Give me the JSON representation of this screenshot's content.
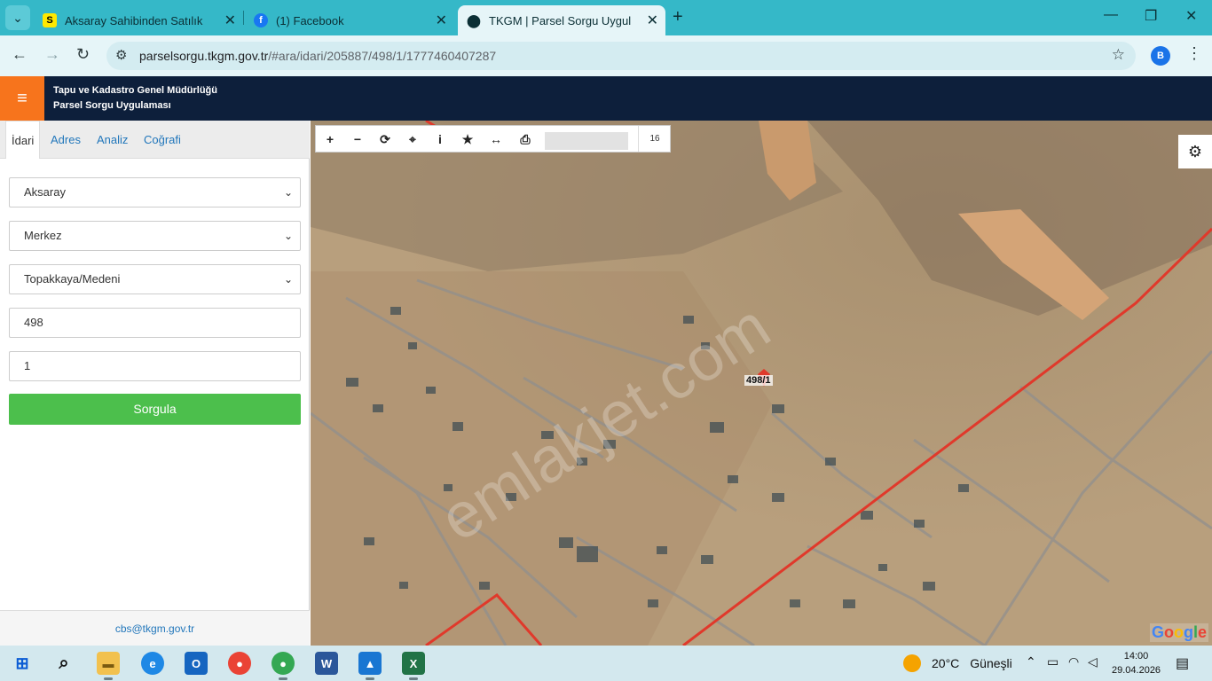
{
  "browser": {
    "tabs": [
      {
        "favicon": "S",
        "title": "Aksaray Sahibinden Satılık Dair"
      },
      {
        "favicon": "facebook-icon",
        "title": "(1) Facebook"
      },
      {
        "favicon": "location-pin-icon",
        "title": "TKGM | Parsel Sorgu Uygulama"
      }
    ],
    "url_host": "parselsorgu.tkgm.gov.tr",
    "url_path": "/#ara/idari/205887/498/1/1777460407287",
    "profile_initial": "B"
  },
  "app": {
    "title_line1": "Tapu ve Kadastro Genel Müdürlüğü",
    "title_line2": "Parsel Sorgu Uygulaması"
  },
  "panel": {
    "tabs": [
      "İdari",
      "Adres",
      "Analiz",
      "Coğrafi"
    ],
    "il": "Aksaray",
    "ilce": "Merkez",
    "mahalle": "Topakkaya/Medeni",
    "ada": "498",
    "parsel": "1",
    "query_button": "Sorgula",
    "footer_email": "cbs@tkgm.gov.tr"
  },
  "map": {
    "zoom_level": "16",
    "parcel_label": "498/1",
    "watermark": "emlakjet.com",
    "provider": "Google",
    "tools": [
      "plus-icon",
      "minus-icon",
      "refresh-icon",
      "locate-icon",
      "info-icon",
      "star-icon",
      "measure-icon",
      "print-icon"
    ]
  },
  "taskbar": {
    "weather_temp": "20°C",
    "weather_text": "Güneşli",
    "time": "14:00",
    "date": "29.04.2026"
  },
  "colors": {
    "tabstrip": "#35b8c8",
    "header": "#0d1f3b",
    "menu_button": "#f7741c",
    "query_button": "#4cbf4c",
    "road": "#e0392b"
  }
}
